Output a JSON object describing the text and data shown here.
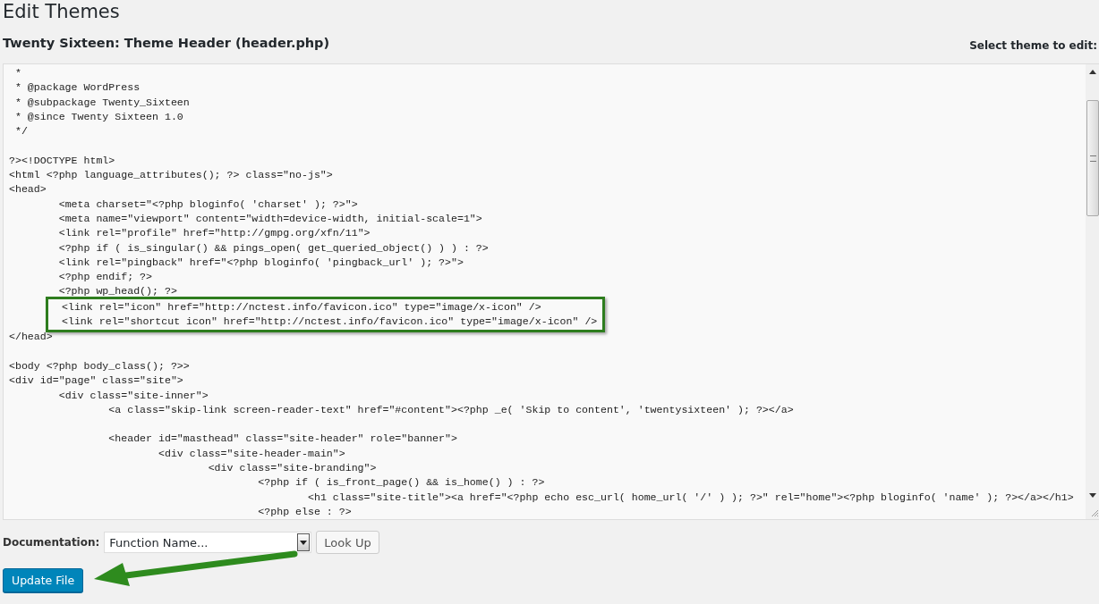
{
  "page_title": "Edit Themes",
  "file_title": "Twenty Sixteen: Theme Header (header.php)",
  "theme_select_label": "Select theme to edit:",
  "editor": {
    "lines": [
      {
        "kind": "code",
        "text": " *",
        "highlighted": false
      },
      {
        "kind": "code",
        "text": " * @package WordPress",
        "highlighted": false
      },
      {
        "kind": "code",
        "text": " * @subpackage Twenty_Sixteen",
        "highlighted": false
      },
      {
        "kind": "code",
        "text": " * @since Twenty Sixteen 1.0",
        "highlighted": false
      },
      {
        "kind": "code",
        "text": " */",
        "highlighted": false
      },
      {
        "kind": "blank"
      },
      {
        "kind": "code",
        "text": "?><!DOCTYPE html>",
        "highlighted": false
      },
      {
        "kind": "code",
        "text": "<html <?php language_attributes(); ?> class=\"no-js\">",
        "highlighted": false
      },
      {
        "kind": "code",
        "text": "<head>",
        "highlighted": false
      },
      {
        "kind": "code",
        "text": "\t<meta charset=\"<?php bloginfo( 'charset' ); ?>\">",
        "highlighted": false
      },
      {
        "kind": "code",
        "text": "\t<meta name=\"viewport\" content=\"width=device-width, initial-scale=1\">",
        "highlighted": false
      },
      {
        "kind": "code",
        "text": "\t<link rel=\"profile\" href=\"http://gmpg.org/xfn/11\">",
        "highlighted": false
      },
      {
        "kind": "code",
        "text": "\t<?php if ( is_singular() && pings_open( get_queried_object() ) ) : ?>",
        "highlighted": false
      },
      {
        "kind": "code",
        "text": "\t<link rel=\"pingback\" href=\"<?php bloginfo( 'pingback_url' ); ?>\">",
        "highlighted": false
      },
      {
        "kind": "code",
        "text": "\t<?php endif; ?>",
        "highlighted": false
      },
      {
        "kind": "code",
        "text": "\t<?php wp_head(); ?>",
        "highlighted": false
      },
      {
        "kind": "code",
        "text": "\t<link rel=\"icon\" href=\"http://nctest.info/favicon.ico\" type=\"image/x-icon\" />",
        "highlighted": true
      },
      {
        "kind": "code",
        "text": "\t<link rel=\"shortcut icon\" href=\"http://nctest.info/favicon.ico\" type=\"image/x-icon\" />",
        "highlighted": true
      },
      {
        "kind": "code",
        "text": "</head>",
        "highlighted": false
      },
      {
        "kind": "blank"
      },
      {
        "kind": "code",
        "text": "<body <?php body_class(); ?>>",
        "highlighted": false
      },
      {
        "kind": "code",
        "text": "<div id=\"page\" class=\"site\">",
        "highlighted": false
      },
      {
        "kind": "code",
        "text": "\t<div class=\"site-inner\">",
        "highlighted": false
      },
      {
        "kind": "code",
        "text": "\t\t<a class=\"skip-link screen-reader-text\" href=\"#content\"><?php _e( 'Skip to content', 'twentysixteen' ); ?></a>",
        "highlighted": false
      },
      {
        "kind": "blank"
      },
      {
        "kind": "code",
        "text": "\t\t<header id=\"masthead\" class=\"site-header\" role=\"banner\">",
        "highlighted": false
      },
      {
        "kind": "code",
        "text": "\t\t\t<div class=\"site-header-main\">",
        "highlighted": false
      },
      {
        "kind": "code",
        "text": "\t\t\t\t<div class=\"site-branding\">",
        "highlighted": false
      },
      {
        "kind": "code",
        "text": "\t\t\t\t\t<?php if ( is_front_page() && is_home() ) : ?>",
        "highlighted": false
      },
      {
        "kind": "code",
        "text": "\t\t\t\t\t\t<h1 class=\"site-title\"><a href=\"<?php echo esc_url( home_url( '/' ) ); ?>\" rel=\"home\"><?php bloginfo( 'name' ); ?></a></h1>",
        "highlighted": false
      },
      {
        "kind": "code",
        "text": "\t\t\t\t\t<?php else : ?>",
        "highlighted": false
      }
    ]
  },
  "documentation": {
    "label": "Documentation:",
    "select_value": "Function Name...",
    "lookup_button": "Look Up"
  },
  "update_button": {
    "label": "Update File",
    "arrow_annotation": true
  }
}
